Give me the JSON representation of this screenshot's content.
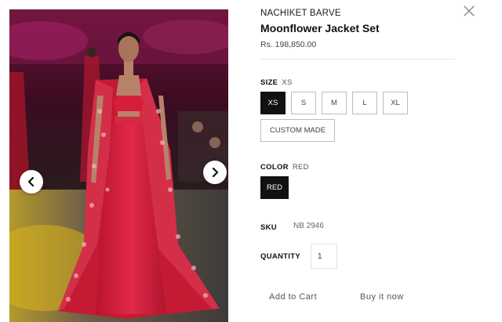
{
  "product": {
    "brand": "NACHIKET BARVE",
    "title": "Moonflower Jacket Set",
    "price": "Rs. 198,850.00"
  },
  "size": {
    "label": "SIZE",
    "selected": "XS",
    "options": [
      "XS",
      "S",
      "M",
      "L",
      "XL",
      "CUSTOM MADE"
    ]
  },
  "color": {
    "label": "COLOR",
    "selected": "RED",
    "options": [
      "RED"
    ]
  },
  "sku": {
    "label": "SKU",
    "value": "NB 2946"
  },
  "quantity": {
    "label": "QUANTITY",
    "value": "1"
  },
  "actions": {
    "add_to_cart": "Add to Cart",
    "buy_now": "Buy it now"
  },
  "icons": {
    "prev": "chevron-left-icon",
    "next": "chevron-right-icon",
    "close": "close-icon"
  },
  "colors": {
    "selected_bg": "#111111",
    "outfit": "#c8203a"
  }
}
